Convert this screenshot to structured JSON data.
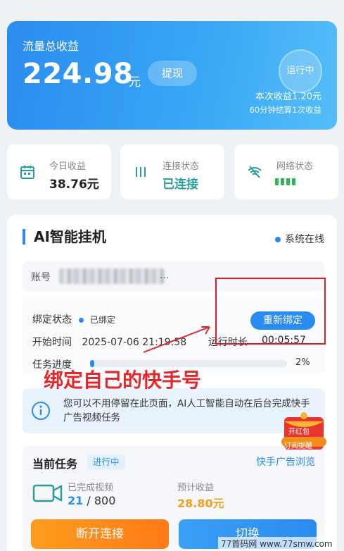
{
  "hero": {
    "title": "流量总收益",
    "amount": "224.98",
    "unit": "元",
    "withdraw_label": "提现",
    "status": "运行中",
    "current_income": "本次收益1.20元",
    "settle_note": "60分钟结算1次收益"
  },
  "stats": [
    {
      "label": "今日收益",
      "value": "38.76元",
      "icon": "calendar-icon"
    },
    {
      "label": "连接状态",
      "value": "已连接",
      "icon": "bars-icon"
    },
    {
      "label": "网络状态",
      "value": "",
      "icon": "wifi-off-icon",
      "signal_bars": 4
    }
  ],
  "panel": {
    "title": "AI智能挂机",
    "online_label": "系统在线",
    "account_label": "账号",
    "account_ellipsis": "...",
    "bind_status_label": "绑定状态",
    "bind_status_value": "已绑定",
    "rebind_label": "重新绑定",
    "start_time_label": "开始时间",
    "start_time_value": "2025-07-06 21:19:58",
    "runtime_label": "运行时长",
    "runtime_value": "00:05:57",
    "progress_label": "任务进度",
    "progress_value": "2%",
    "progress_fraction": 0.02,
    "info_text": "您可以不用停留在此页面，AI人工智能自动在后台完成快手广告视频任务"
  },
  "annotation": {
    "text": "绑定自己的快手号",
    "color": "#e4262d"
  },
  "task": {
    "title": "当前任务",
    "badge": "进行中",
    "link": "快手广告浏览",
    "done_label": "已完成视频",
    "done_count": "21",
    "done_total": " / 800",
    "est_label": "预计收益",
    "est_value": "28.80元",
    "stop_label": "断开连接",
    "switch_label": "切换"
  },
  "redpack": {
    "line1": "开红包",
    "line2": "订阅提醒"
  },
  "watermark": "77首码网 www.77smw.com"
}
